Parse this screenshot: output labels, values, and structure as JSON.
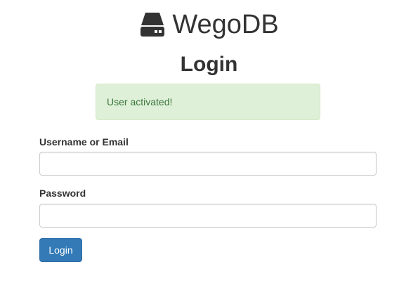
{
  "brand": {
    "name": "WegoDB",
    "icon": "hard-drive-icon"
  },
  "page": {
    "title": "Login"
  },
  "alert": {
    "message": "User activated!"
  },
  "form": {
    "username_label": "Username or Email",
    "username_value": "",
    "password_label": "Password",
    "password_value": "",
    "submit_label": "Login"
  },
  "colors": {
    "primary": "#337ab7",
    "success_bg": "#dff0d8",
    "success_text": "#3c763d",
    "text": "#333333"
  }
}
